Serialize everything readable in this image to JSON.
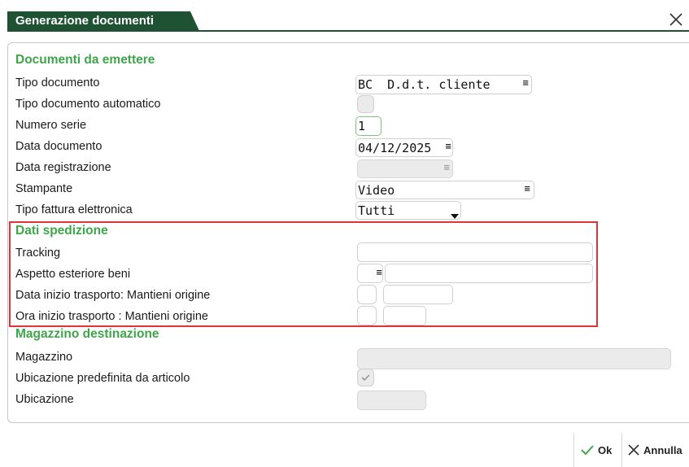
{
  "window": {
    "title": "Generazione documenti"
  },
  "sections": {
    "documenti": "Documenti da emettere",
    "spedizione": "Dati spedizione",
    "magazzino": "Magazzino destinazione"
  },
  "fields": {
    "tipo_documento": {
      "label": "Tipo documento",
      "value": "BC  D.d.t. cliente"
    },
    "tipo_documento_automatico": {
      "label": "Tipo documento automatico"
    },
    "numero_serie": {
      "label": "Numero serie",
      "value": "1"
    },
    "data_documento": {
      "label": "Data documento",
      "value": "04/12/2025"
    },
    "data_registrazione": {
      "label": "Data registrazione",
      "value": ""
    },
    "stampante": {
      "label": "Stampante",
      "value": "Video"
    },
    "tipo_fattura": {
      "label": "Tipo fattura elettronica",
      "value": "Tutti"
    },
    "tracking": {
      "label": "Tracking",
      "value": ""
    },
    "aspetto": {
      "label": "Aspetto esteriore beni",
      "value": ""
    },
    "data_inizio": {
      "label": "Data inizio trasporto: Mantieni origine",
      "value": ""
    },
    "ora_inizio": {
      "label": "Ora inizio trasporto : Mantieni origine",
      "value": ""
    },
    "magazzino": {
      "label": "Magazzino",
      "value": ""
    },
    "ubicazione_predefinita": {
      "label": "Ubicazione predefinita da articolo",
      "checked": true
    },
    "ubicazione": {
      "label": "Ubicazione",
      "value": ""
    }
  },
  "buttons": {
    "ok": "Ok",
    "annulla": "Annulla"
  },
  "glyphs": {
    "menu": "≡"
  },
  "colors": {
    "title_bg": "#1e5233",
    "section_text": "#3ea64a",
    "highlight": "#e0343a",
    "confirm_check": "#3ea64a"
  }
}
